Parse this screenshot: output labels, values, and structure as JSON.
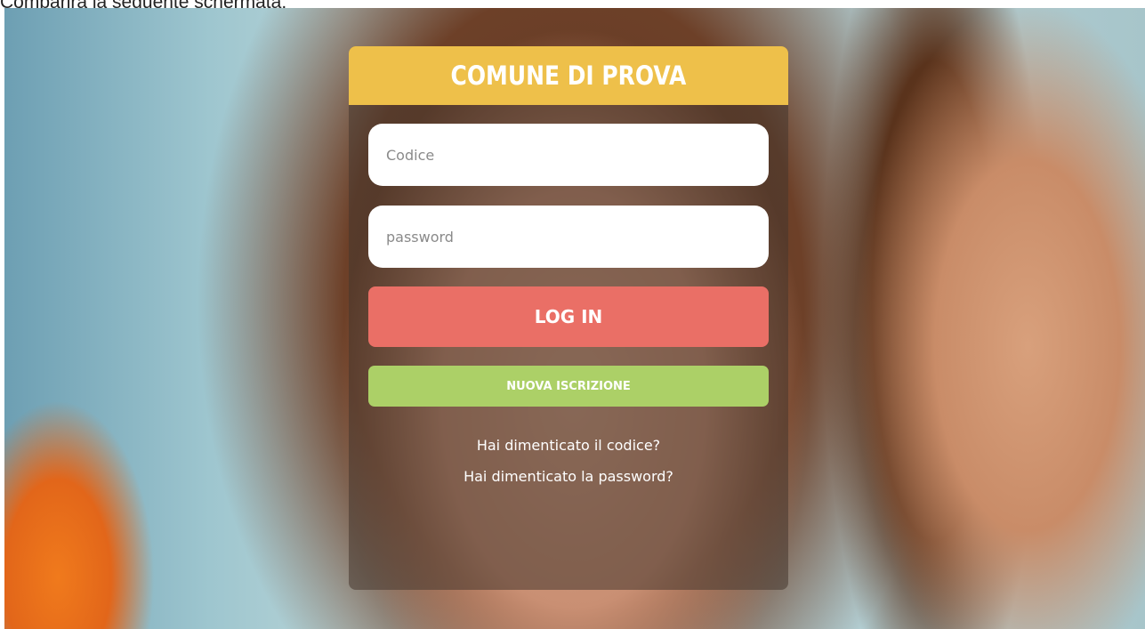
{
  "caption": "Comparirà la seguente schermata:",
  "login": {
    "title": "COMUNE DI PROVA",
    "code_placeholder": "Codice",
    "password_placeholder": "password",
    "login_label": "LOG IN",
    "register_label": "NUOVA ISCRIZIONE",
    "forgot_code": "Hai dimenticato il codice?",
    "forgot_password": "Hai dimenticato la password?"
  },
  "colors": {
    "header": "#eec04a",
    "login_button": "#ea6f66",
    "register_button": "#acd067"
  }
}
